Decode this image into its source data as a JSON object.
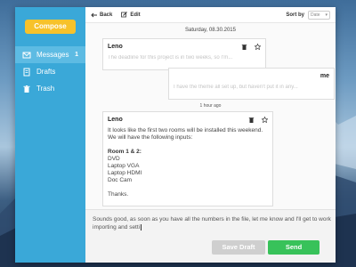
{
  "sidebar": {
    "compose_label": "Compose",
    "items": [
      {
        "label": "Messages",
        "count": "1",
        "icon": "envelope-icon"
      },
      {
        "label": "Drafts",
        "icon": "document-icon"
      },
      {
        "label": "Trash",
        "icon": "trash-icon"
      }
    ]
  },
  "toolbar": {
    "back_label": "Back",
    "edit_label": "Edit",
    "sort_label": "Sort by",
    "sort_value": "Date"
  },
  "thread": {
    "date": "Saturday, 08.30.2015",
    "time_separator": "1 hour ago",
    "messages": [
      {
        "sender": "Leno",
        "preview": "The deadline for this project is in two weeks, so I'm..."
      },
      {
        "sender": "me",
        "preview": "I have the theme all set up, but haven't put it in any..."
      },
      {
        "sender": "Leno",
        "body": {
          "intro": "It looks like the first two rooms will be installed this weekend. We will have the following inputs:",
          "heading": "Room 1 & 2:",
          "items": [
            "DVD",
            "Laptop VGA",
            "Laptop HDMI",
            "Doc Cam"
          ],
          "closing": "Thanks."
        }
      }
    ]
  },
  "reply": {
    "text": "Sounds good, as soon as you have all the numbers in the file, let me know and I'll get to work importing and setti",
    "draft_label": "Save Draft",
    "send_label": "Send"
  },
  "colors": {
    "sidebar": "#3aa8d8",
    "compose": "#f7c22b",
    "send": "#38c25a",
    "draft": "#cfcfcf"
  }
}
